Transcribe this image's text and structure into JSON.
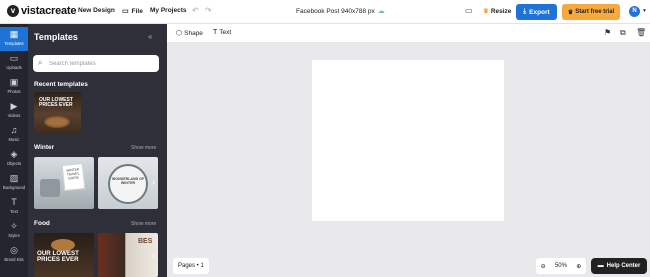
{
  "header": {
    "brand": "vistacreate",
    "nav": [
      "New Design",
      "File",
      "My Projects"
    ],
    "doc_title": "Facebook Post 940x788 px",
    "resize_label": "Resize",
    "export_label": "Export",
    "trial_label": "Start free trial",
    "avatar_initial": "N"
  },
  "rail": {
    "items": [
      {
        "label": "Templates",
        "icon": "templates-icon"
      },
      {
        "label": "Uploads",
        "icon": "uploads-icon"
      },
      {
        "label": "Photos",
        "icon": "photos-icon"
      },
      {
        "label": "Videos",
        "icon": "videos-icon"
      },
      {
        "label": "Music",
        "icon": "music-icon"
      },
      {
        "label": "Objects",
        "icon": "objects-icon"
      },
      {
        "label": "Background",
        "icon": "background-icon"
      },
      {
        "label": "Text",
        "icon": "text-icon"
      },
      {
        "label": "Styles",
        "icon": "styles-icon"
      },
      {
        "label": "Brand Kits",
        "icon": "brand-kits-icon"
      }
    ]
  },
  "panel": {
    "title": "Templates",
    "search_placeholder": "Search templates",
    "recent_title": "Recent templates",
    "winter_title": "Winter",
    "winter_more": "Show more",
    "food_title": "Food",
    "food_more": "Show more",
    "thumb_recent_text": "OUR LOWEST PRICES EVER",
    "thumb_winter1_text": "WINTER TRAVEL GUIDE",
    "thumb_winter2_text": "WONDERLAND OF WINTER",
    "thumb_food1_text": "OUR LOWEST PRICES EVER",
    "thumb_food2_text": "BES"
  },
  "toolbar": {
    "shape_label": "Shape",
    "text_label": "Text"
  },
  "footer": {
    "pages_label": "Pages • 1",
    "zoom_value": "50%",
    "help_label": "Help Center"
  }
}
